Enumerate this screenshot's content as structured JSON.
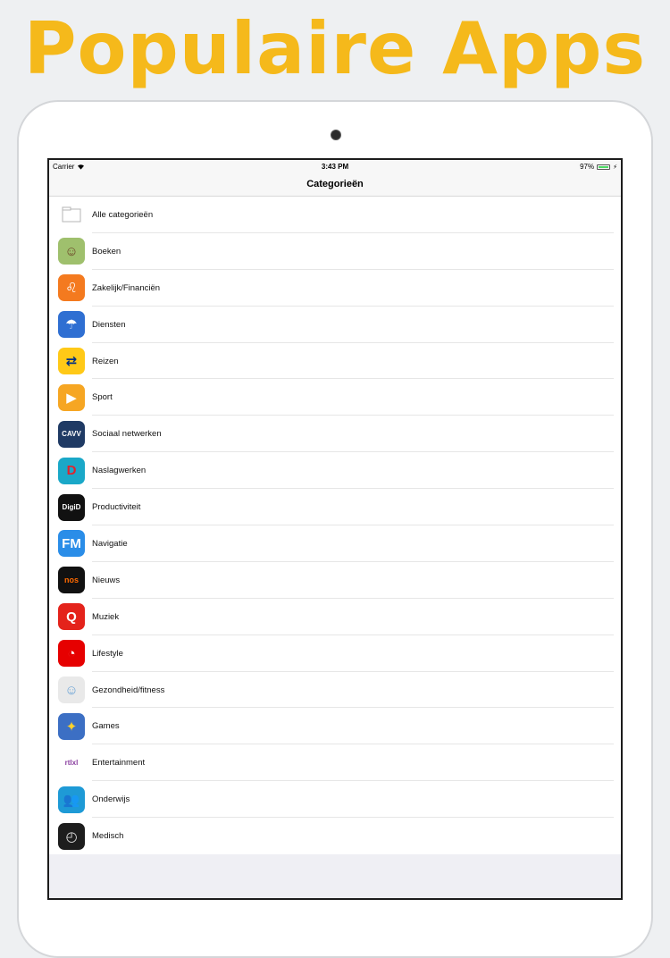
{
  "headline": "Populaire Apps",
  "status": {
    "carrier": "Carrier",
    "time": "3:43 PM",
    "battery": "97%",
    "battery_level": 0.97
  },
  "nav": {
    "title": "Categorieën"
  },
  "colors": {
    "headline": "#f5b91b",
    "battery": "#4cd964"
  },
  "categories": [
    {
      "label": "Alle categorieën",
      "icon": "folder-icon",
      "icon_text": "",
      "bg": "#ffffff",
      "fg": "#999999"
    },
    {
      "label": "Boeken",
      "icon": "book-character-icon",
      "icon_text": "☺",
      "bg": "#9fc06d",
      "fg": "#6b4226"
    },
    {
      "label": "Zakelijk/Financiën",
      "icon": "lion-icon",
      "icon_text": "♌",
      "bg": "#f47a1f",
      "fg": "#ffffff"
    },
    {
      "label": "Diensten",
      "icon": "weather-alert-icon",
      "icon_text": "☂",
      "bg": "#2f6fd2",
      "fg": "#ffffff"
    },
    {
      "label": "Reizen",
      "icon": "ns-train-icon",
      "icon_text": "⇄",
      "bg": "#ffc917",
      "fg": "#003082"
    },
    {
      "label": "Sport",
      "icon": "sport-play-icon",
      "icon_text": "▶",
      "bg": "#f6a623",
      "fg": "#ffffff"
    },
    {
      "label": "Sociaal netwerken",
      "icon": "cavv-icon",
      "icon_text": "CAVV",
      "bg": "#1f3a64",
      "fg": "#ffffff"
    },
    {
      "label": "Naslagwerken",
      "icon": "pocket-dictionary-icon",
      "icon_text": "D",
      "bg": "#1aa8c8",
      "fg": "#e3222b"
    },
    {
      "label": "Productiviteit",
      "icon": "digid-icon",
      "icon_text": "DigiD",
      "bg": "#111111",
      "fg": "#ffffff"
    },
    {
      "label": "Navigatie",
      "icon": "fm-radio-icon",
      "icon_text": "FM",
      "bg": "#2a8de8",
      "fg": "#ffffff"
    },
    {
      "label": "Nieuws",
      "icon": "nos-icon",
      "icon_text": "nos",
      "bg": "#111111",
      "fg": "#ff6a00"
    },
    {
      "label": "Muziek",
      "icon": "qmusic-icon",
      "icon_text": "Q",
      "bg": "#e4231b",
      "fg": "#ffffff"
    },
    {
      "label": "Lifestyle",
      "icon": "vodafone-icon",
      "icon_text": "◔",
      "bg": "#e60000",
      "fg": "#ffffff"
    },
    {
      "label": "Gezondheid/fitness",
      "icon": "baby-icon",
      "icon_text": "☺",
      "bg": "#e9e9e9",
      "fg": "#6aa3d6"
    },
    {
      "label": "Games",
      "icon": "games-icon",
      "icon_text": "✦",
      "bg": "#3c6fc4",
      "fg": "#ffd12a"
    },
    {
      "label": "Entertainment",
      "icon": "rtlxl-icon",
      "icon_text": "rtlxl",
      "bg": "#ffffff",
      "fg": "#8a3fa0"
    },
    {
      "label": "Onderwijs",
      "icon": "people-icon",
      "icon_text": "👥",
      "bg": "#1e9ad6",
      "fg": "#ffffff"
    },
    {
      "label": "Medisch",
      "icon": "gauge-icon",
      "icon_text": "◴",
      "bg": "#1d1d1d",
      "fg": "#e0e0e0"
    }
  ]
}
